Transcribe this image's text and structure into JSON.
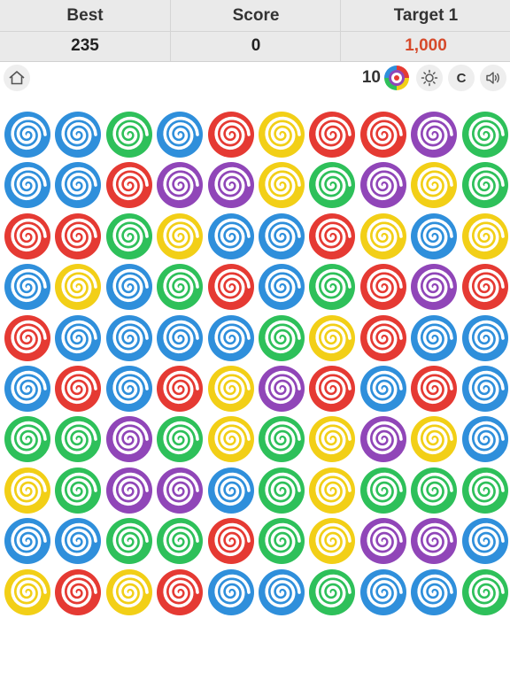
{
  "header": {
    "best_label": "Best",
    "best_value": "235",
    "score_label": "Score",
    "score_value": "0",
    "target_label": "Target 1",
    "target_value": "1,000"
  },
  "toolbar": {
    "home_icon": "home-icon",
    "moves_count": "10",
    "moves_icon": "rainbow-swirl-icon",
    "brightness_icon": "sun-icon",
    "c_button_label": "C",
    "sound_icon": "speaker-icon"
  },
  "colors": {
    "B": "#2f8fdb",
    "G": "#2ec05a",
    "R": "#e53a33",
    "Y": "#f2cf17",
    "P": "#9046b8",
    "target_text": "#d64a2b"
  },
  "board": {
    "rows": 10,
    "cols": 10,
    "grid": [
      [
        "B",
        "B",
        "G",
        "B",
        "R",
        "Y",
        "R",
        "R",
        "P",
        "G"
      ],
      [
        "B",
        "B",
        "R",
        "P",
        "P",
        "Y",
        "G",
        "P",
        "Y",
        "G"
      ],
      [
        "R",
        "R",
        "G",
        "Y",
        "B",
        "B",
        "R",
        "Y",
        "B",
        "Y"
      ],
      [
        "B",
        "Y",
        "B",
        "G",
        "R",
        "B",
        "G",
        "R",
        "P",
        "R"
      ],
      [
        "R",
        "B",
        "B",
        "B",
        "B",
        "G",
        "Y",
        "R",
        "B",
        "B"
      ],
      [
        "B",
        "R",
        "B",
        "R",
        "Y",
        "P",
        "R",
        "B",
        "R",
        "B"
      ],
      [
        "G",
        "G",
        "P",
        "G",
        "Y",
        "G",
        "Y",
        "P",
        "Y",
        "B"
      ],
      [
        "Y",
        "G",
        "P",
        "P",
        "B",
        "G",
        "Y",
        "G",
        "G",
        "G"
      ],
      [
        "B",
        "B",
        "G",
        "G",
        "R",
        "G",
        "Y",
        "P",
        "P",
        "B"
      ],
      [
        "Y",
        "R",
        "Y",
        "R",
        "B",
        "B",
        "G",
        "B",
        "B",
        "G"
      ]
    ]
  }
}
